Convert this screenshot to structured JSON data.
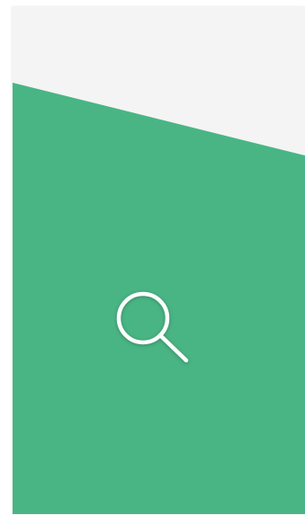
{
  "theme": {
    "background_color": "#f4f4f4",
    "accent_color": "#49b584",
    "icon_color": "#ffffff"
  },
  "search": {
    "icon": "search-icon"
  }
}
